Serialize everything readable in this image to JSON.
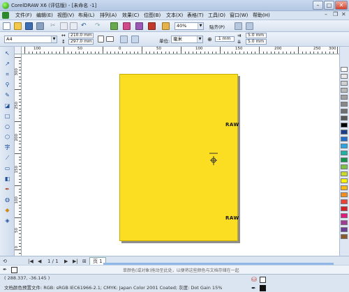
{
  "window": {
    "title": "CorelDRAW X6 (评估版) - [未命名 -1]",
    "controls": [
      "–",
      "□",
      "✕"
    ]
  },
  "menu": {
    "items": [
      "文件(F)",
      "编辑(E)",
      "视图(V)",
      "布局(L)",
      "排列(A)",
      "效果(C)",
      "位图(B)",
      "文本(X)",
      "表格(T)",
      "工具(O)",
      "窗口(W)",
      "帮助(H)"
    ]
  },
  "toolbar": {
    "zoom": "40%",
    "snap": "贴齐(P)"
  },
  "property_bar": {
    "paper": "A4",
    "width": "210.0 mm",
    "height": "297.0 mm",
    "units_label": "单位:",
    "units": "毫米",
    "nudge": ".1 mm",
    "dup_x": "5.0 mm",
    "dup_y": "5.0 mm"
  },
  "ruler": {
    "h_labels": [
      "100",
      "50",
      "0",
      "50",
      "100",
      "150",
      "200",
      "250",
      "300"
    ],
    "v_labels": [
      "300",
      "250",
      "200",
      "150",
      "100",
      "50",
      "0"
    ]
  },
  "page": {
    "fill_color": "#fbde21",
    "raw_text": "RAW"
  },
  "nav": {
    "page_count": "1 / 1",
    "page_tab": "页 1",
    "hint": "单颜色(或对象)拖动至此处，以便将这些颜色与文档存储在一起"
  },
  "status": {
    "coords": "( 288.337, -36.145 )",
    "profile": "文档颜色预置文件: RGB: sRGB IEC61966-2.1; CMYK: Japan Color 2001 Coated; 灰度: Dot Gain 15%"
  },
  "palette": [
    "#ffffff",
    "#e8e8e8",
    "#d0d0d0",
    "#b8b8b8",
    "#a0a0a0",
    "#888888",
    "#707070",
    "#585858",
    "#000000",
    "#1a3d8f",
    "#1f6fd0",
    "#27a6e3",
    "#1bb3a3",
    "#11964b",
    "#7dc242",
    "#c8d92b",
    "#fff200",
    "#fcb913",
    "#f38d1b",
    "#ee4036",
    "#d81f26",
    "#e3197d",
    "#a23a96",
    "#6d3c97",
    "#8b5a2b"
  ]
}
